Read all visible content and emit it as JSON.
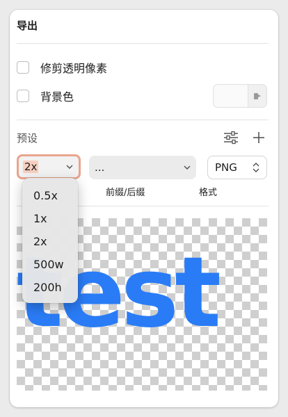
{
  "panel": {
    "title": "导出",
    "trim_label": "修剪透明像素",
    "background_label": "背景色"
  },
  "presets": {
    "label": "预设",
    "scale_value": "2x",
    "suffix_value": "...",
    "format_value": "PNG",
    "suffix_label": "前缀/后缀",
    "format_label": "格式"
  },
  "scale_menu": {
    "items": [
      "0.5x",
      "1x",
      "2x",
      "500w",
      "200h"
    ]
  },
  "preview": {
    "text": "test",
    "text_color": "#2a7cf6"
  },
  "icons": {
    "settings": "sliders-icon",
    "add": "plus-icon",
    "eyedropper": "eyedropper-icon"
  }
}
